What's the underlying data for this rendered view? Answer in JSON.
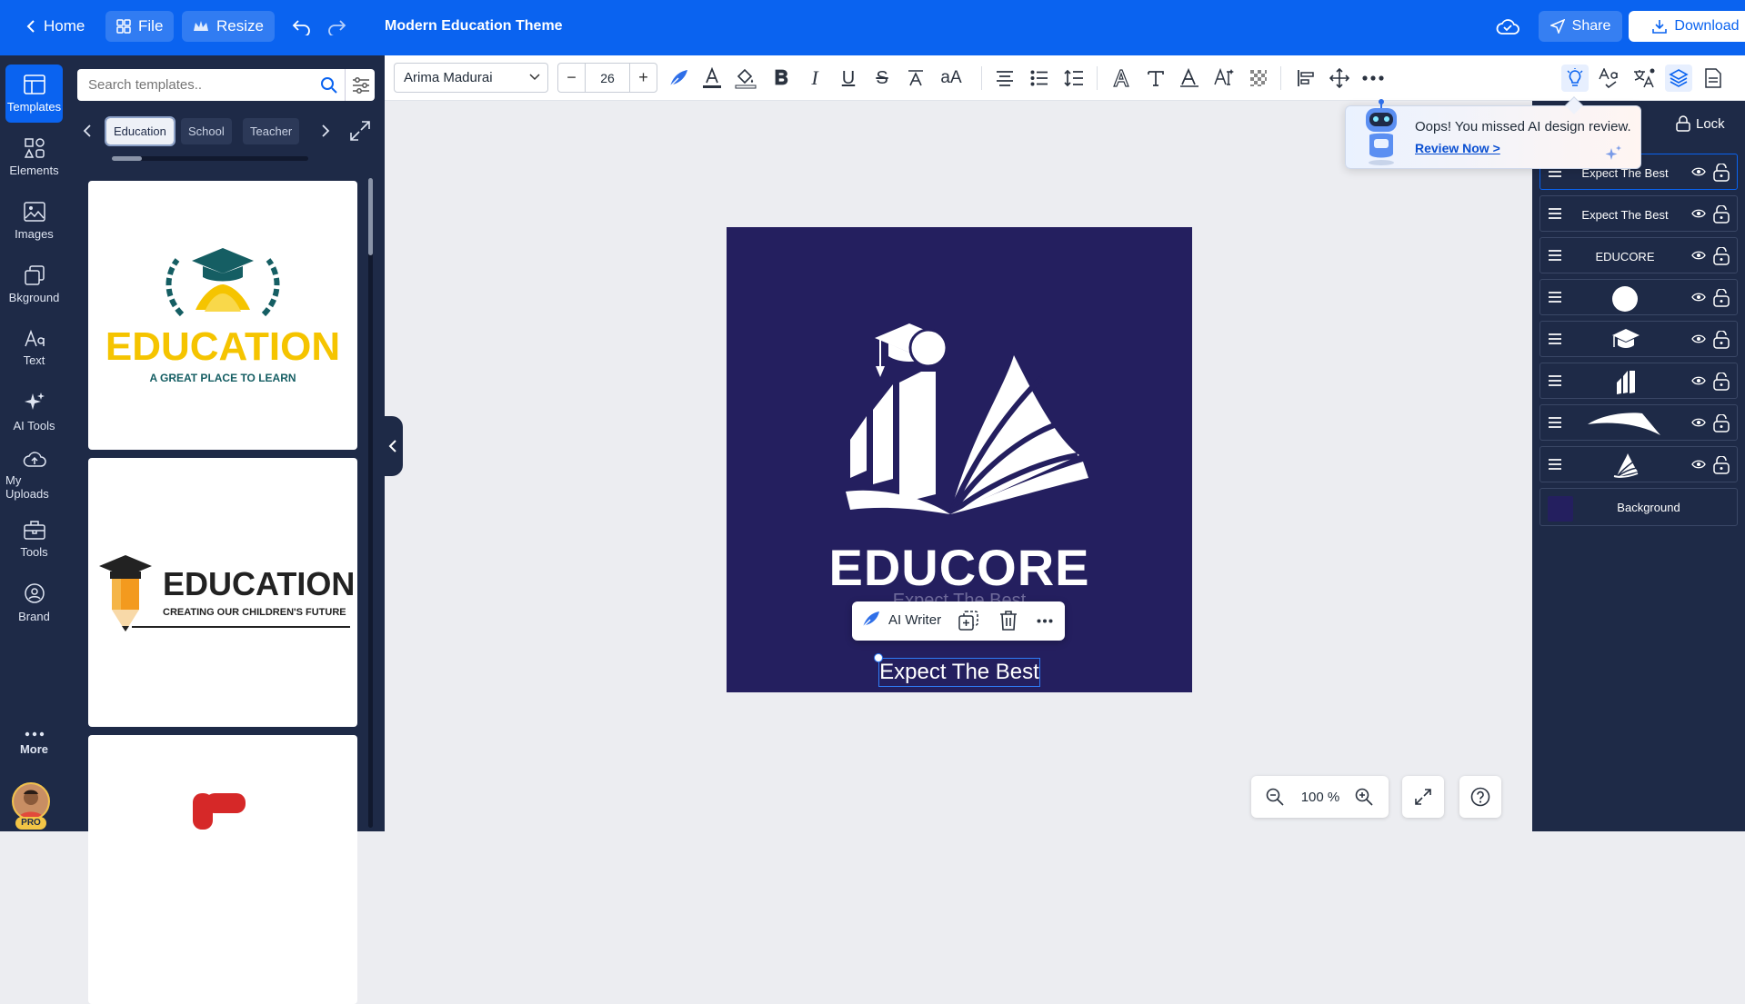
{
  "topbar": {
    "home": "Home",
    "file": "File",
    "resize": "Resize",
    "title": "Modern Education Theme",
    "share": "Share",
    "download": "Download",
    "bg_color": "#0a63f0"
  },
  "leftnav": {
    "items": [
      {
        "label": "Templates",
        "icon": "templates-icon"
      },
      {
        "label": "Elements",
        "icon": "elements-icon"
      },
      {
        "label": "Images",
        "icon": "images-icon"
      },
      {
        "label": "Bkground",
        "icon": "background-icon"
      },
      {
        "label": "Text",
        "icon": "text-icon"
      },
      {
        "label": "AI Tools",
        "icon": "sparkle-icon"
      },
      {
        "label": "My Uploads",
        "icon": "upload-icon"
      },
      {
        "label": "Tools",
        "icon": "toolbox-icon"
      },
      {
        "label": "Brand",
        "icon": "brand-icon"
      }
    ],
    "more": "More",
    "pro_badge": "PRO"
  },
  "panel": {
    "search_placeholder": "Search templates..",
    "chips": [
      "Education",
      "School",
      "Teacher"
    ],
    "templates": [
      {
        "headline": "EDUCATION",
        "subline": "A GREAT PLACE TO LEARN"
      },
      {
        "headline": "EDUCATION",
        "subline": "CREATING OUR CHILDREN'S FUTURE"
      }
    ]
  },
  "toolbar": {
    "font": "Arima Madurai",
    "font_size": "26",
    "minus": "−",
    "plus": "+",
    "case_toggle": "aA"
  },
  "canvas": {
    "brand": "EDUCORE",
    "tagline": "Expect The Best",
    "bg_color": "#241f5f",
    "float_bar": {
      "ai_writer": "AI Writer"
    }
  },
  "zoom": {
    "value": "100 %"
  },
  "layers": {
    "lock": "Lock",
    "items": [
      {
        "label": "Expect The Best",
        "type": "text"
      },
      {
        "label": "Expect The Best",
        "type": "text"
      },
      {
        "label": "EDUCORE",
        "type": "text"
      },
      {
        "label": "",
        "type": "circle"
      },
      {
        "label": "",
        "type": "cap"
      },
      {
        "label": "",
        "type": "bars"
      },
      {
        "label": "",
        "type": "swoosh"
      },
      {
        "label": "",
        "type": "book"
      }
    ],
    "background": "Background"
  },
  "tooltip": {
    "message": "Oops! You missed AI design review.",
    "link": "Review Now >"
  }
}
